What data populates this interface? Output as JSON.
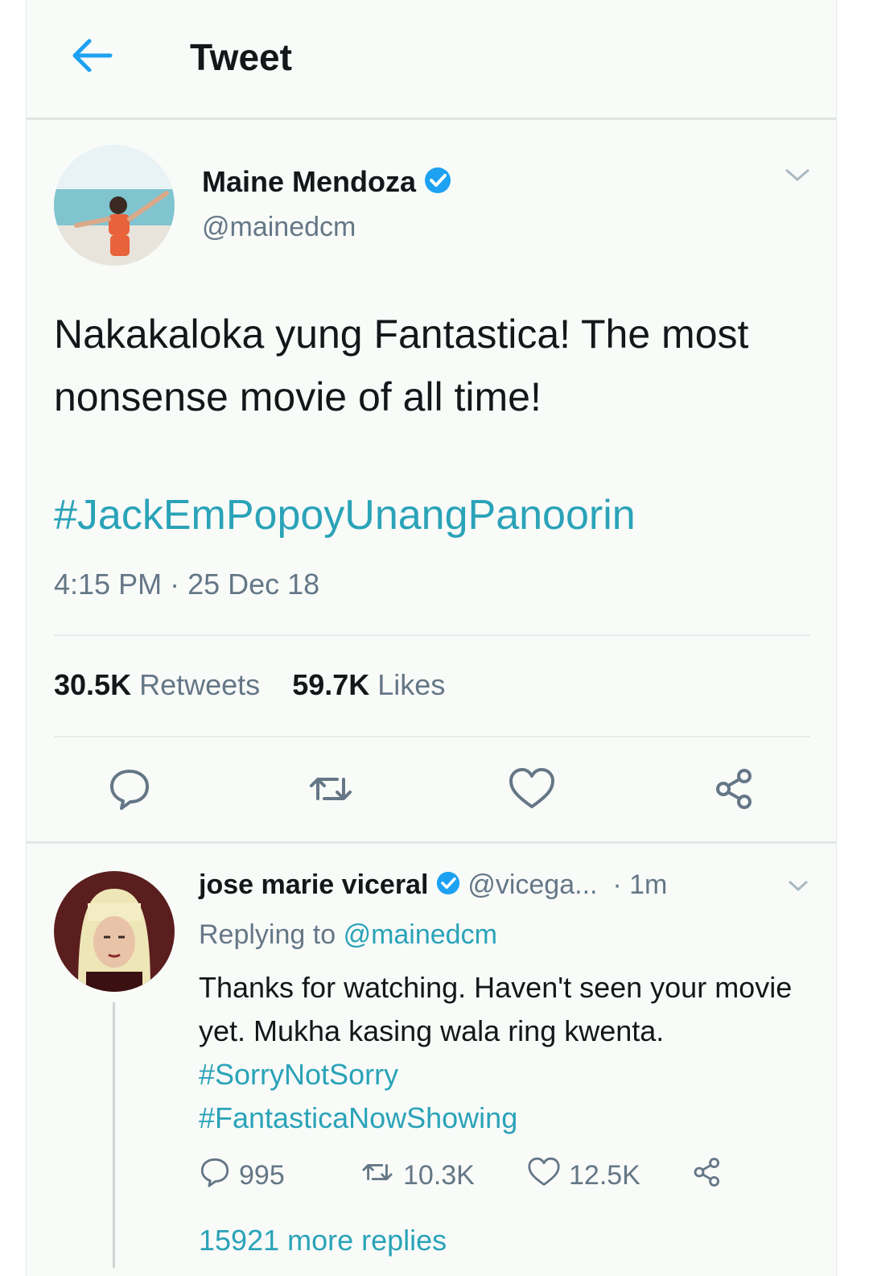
{
  "header": {
    "title": "Tweet"
  },
  "tweet": {
    "author_name": "Maine Mendoza",
    "author_handle": "@mainedcm",
    "text": "Nakakaloka yung Fantastica! The most nonsense movie of all time!",
    "hashtag": "#JackEmPopoyUnangPanoorin",
    "time": "4:15 PM",
    "date": "25 Dec 18",
    "retweets_count": "30.5K",
    "retweets_label": "Retweets",
    "likes_count": "59.7K",
    "likes_label": "Likes"
  },
  "reply": {
    "author_name": "jose marie viceral",
    "author_handle": "@vicega...",
    "age": "1m",
    "replying_prefix": "Replying to",
    "replying_to": "@mainedcm",
    "text": "Thanks for watching. Haven't seen your movie yet. Mukha kasing wala ring kwenta.",
    "hashtag1": "#SorryNotSorry",
    "hashtag2": "#FantasticaNowShowing",
    "reply_count": "995",
    "retweet_count": "10.3K",
    "like_count": "12.5K",
    "more_replies": "15921 more replies"
  },
  "colors": {
    "accent": "#2aa3b8",
    "verified": "#1da1f2",
    "muted": "#657786"
  }
}
